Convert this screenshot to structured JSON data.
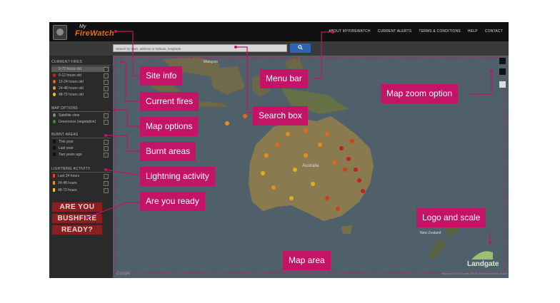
{
  "header": {
    "logo_my": "My",
    "logo_firewatch": "FireWatch",
    "nav": [
      "ABOUT MYFIREWATCH",
      "CURRENT ALERTS",
      "TERMS & CONDITIONS",
      "HELP",
      "CONTACT"
    ]
  },
  "search": {
    "placeholder": "Search by town, address or latitude, longitude",
    "button_icon": "search-icon"
  },
  "sidebar": {
    "current_fires": {
      "title": "CURRENT FIRES",
      "items": [
        {
          "label": "0-72 hours old",
          "selected": true,
          "color": ""
        },
        {
          "label": "0-12 hours old",
          "color": "#d0202a"
        },
        {
          "label": "12-24 hours old",
          "color": "#e8641b"
        },
        {
          "label": "24-48 hours old",
          "color": "#f0951e"
        },
        {
          "label": "48-72 hours old",
          "color": "#f5c31f"
        }
      ]
    },
    "map_options": {
      "title": "MAP OPTIONS",
      "items": [
        {
          "label": "Satellite view",
          "icon": "globe-icon"
        },
        {
          "label": "Greenness (vegetation)",
          "icon": "tree-icon"
        }
      ]
    },
    "burnt_areas": {
      "title": "BURNT AREAS",
      "items": [
        {
          "label": "This year"
        },
        {
          "label": "Last year"
        },
        {
          "label": "Two years ago"
        }
      ]
    },
    "lightning": {
      "title": "LIGHTNING ACTIVITY",
      "items": [
        {
          "label": "Last 24 hours",
          "color": "#e04020"
        },
        {
          "label": "24-48 hours",
          "color": "#f08a20"
        },
        {
          "label": "48-72 hours",
          "color": "#f5c030"
        }
      ]
    },
    "ready_lines": [
      "ARE YOU",
      "BUSHFIRE",
      "READY?"
    ]
  },
  "map": {
    "labels": {
      "malaysia": "Malaysia",
      "australia": "Australia",
      "new_zealand": "New Zealand"
    },
    "google": "Google",
    "attribution": "Map data ©2016 Google, INEGI, Whitehead  |  Terms of Use",
    "landgate": "Landgate"
  },
  "annotations": [
    "Site info",
    "Current fires",
    "Map options",
    "Burnt areas",
    "Lightning activity",
    "Are you ready",
    "Menu bar",
    "Search box",
    "Map zoom option",
    "Logo and scale",
    "Map area"
  ],
  "colors": {
    "callout": "#c41467",
    "dashed": "#c41467",
    "search_button": "#2f63b6"
  }
}
